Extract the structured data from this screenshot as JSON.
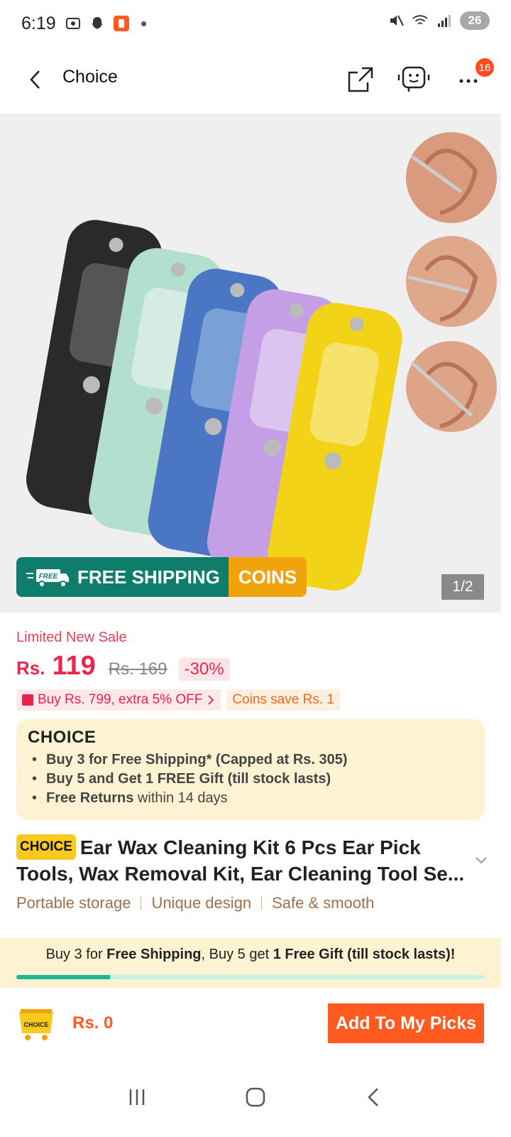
{
  "status_bar": {
    "time": "6:19",
    "battery": "26"
  },
  "header": {
    "title": "Choice",
    "notification_count": "16",
    "icons": [
      "back-icon",
      "share-icon",
      "support-bot-icon",
      "more-icon"
    ]
  },
  "hero": {
    "pager": "1/2",
    "free_shipping_label": "FREE SHIPPING",
    "free_badge": "FREE",
    "coins_label": "COINS"
  },
  "pricing": {
    "sale_label": "Limited New Sale",
    "currency": "Rs.",
    "price": "119",
    "original_price": "Rs. 169",
    "discount": "-30%",
    "coupon_pink": "Buy Rs. 799, extra 5% OFF",
    "coupon_orange": "Coins save Rs. 1"
  },
  "choice_card": {
    "logo": "CHOICE",
    "bullets": [
      {
        "bold": "Buy 3 for  Free Shipping* (Capped at Rs. 305)",
        "rest": ""
      },
      {
        "bold": "Buy 5 and Get 1 FREE Gift (till stock lasts)",
        "rest": ""
      },
      {
        "bold": "Free Returns",
        "rest": " within 14 days"
      }
    ]
  },
  "product": {
    "tag": "CHOICE",
    "title": "Ear Wax Cleaning Kit 6 Pcs Ear Pick Tools, Wax Removal Kit, Ear Cleaning Tool Se...",
    "features": [
      "Portable storage",
      "Unique design",
      "Safe & smooth"
    ]
  },
  "sticky": {
    "t1": "Buy 3 for ",
    "t2": "Free Shipping",
    "t3": ", Buy 5 get ",
    "t4": "1 Free Gift (till stock lasts)!",
    "progress": 0.2
  },
  "cta": {
    "cart_label": "CHOICE",
    "total": "Rs. 0",
    "add_button": "Add To My Picks"
  },
  "colors": {
    "accent": "#ff5a1f",
    "price": "#e8284b",
    "choice_yellow": "#f8c91e",
    "free_shipping_green": "#0e7d6b",
    "coins_orange": "#f0a30a"
  }
}
